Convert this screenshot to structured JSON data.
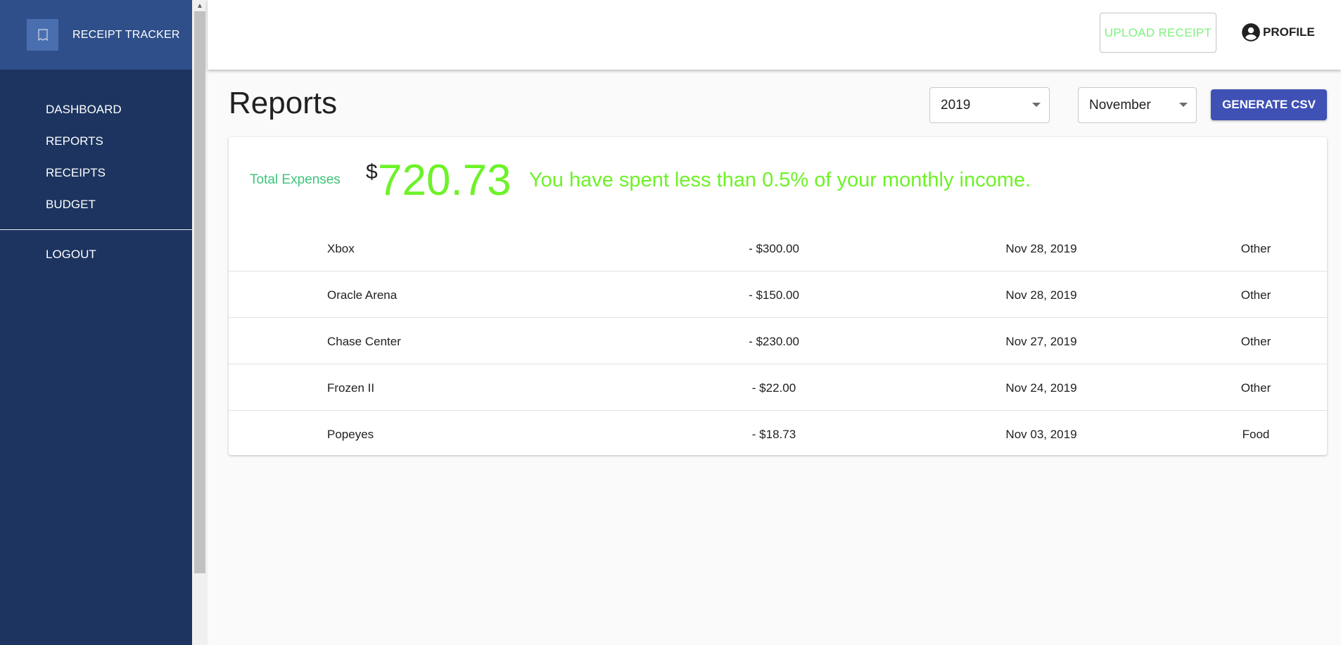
{
  "sidebar": {
    "brand": {
      "title": "RECEIPT TRACKER",
      "icon": "receipt-icon"
    },
    "items": [
      {
        "label": "DASHBOARD"
      },
      {
        "label": "REPORTS"
      },
      {
        "label": "RECEIPTS"
      },
      {
        "label": "BUDGET"
      }
    ],
    "logout": "LOGOUT",
    "colors": {
      "background": "#1c345f",
      "brand_background": "#2f4f8a"
    }
  },
  "header": {
    "upload_label": "UPLOAD RECEIPT",
    "profile_label": "PROFILE",
    "profile_icon": "account-circle-icon"
  },
  "page": {
    "title": "Reports",
    "year": "2019",
    "month": "November",
    "csv_label": "GENERATE CSV"
  },
  "summary": {
    "label": "Total Expenses",
    "currency": "$",
    "total": "720.73",
    "message": "You have spent less than 0.5% of your monthly income."
  },
  "expenses": [
    {
      "name": "Xbox",
      "amount": "- $300.00",
      "date": "Nov 28, 2019",
      "category": "Other"
    },
    {
      "name": "Oracle Arena",
      "amount": "- $150.00",
      "date": "Nov 28, 2019",
      "category": "Other"
    },
    {
      "name": "Chase Center",
      "amount": "- $230.00",
      "date": "Nov 27, 2019",
      "category": "Other"
    },
    {
      "name": "Frozen II",
      "amount": "- $22.00",
      "date": "Nov 24, 2019",
      "category": "Other"
    },
    {
      "name": "Popeyes",
      "amount": "- $18.73",
      "date": "Nov 03, 2019",
      "category": "Food"
    }
  ],
  "colors": {
    "accent": "#3f51b5",
    "total_green": "#6df228",
    "label_green": "#3cc57a",
    "upload_green": "#7cf27c"
  }
}
